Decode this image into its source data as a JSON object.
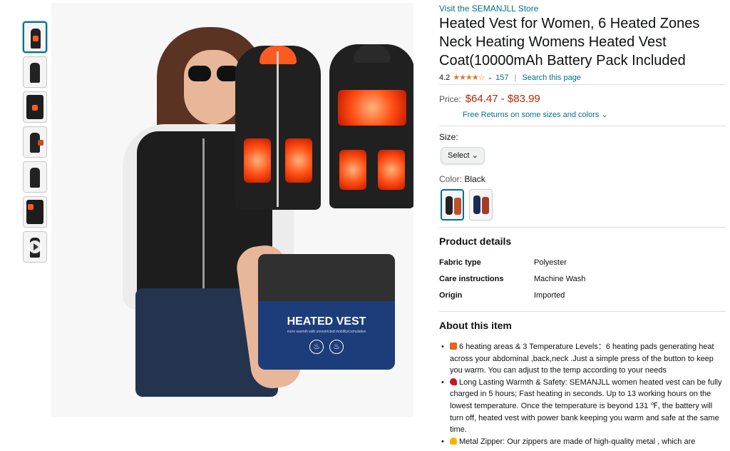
{
  "thumbnails": [
    {
      "kind": "image",
      "active": true
    },
    {
      "kind": "image"
    },
    {
      "kind": "image"
    },
    {
      "kind": "image"
    },
    {
      "kind": "image"
    },
    {
      "kind": "image"
    },
    {
      "kind": "video"
    }
  ],
  "main_image": {
    "bag_label": "HEATED VEST",
    "bag_sub": "more warmth with unrestricted mobility/cumulative"
  },
  "store_link": "Visit the SEMANJLL Store",
  "title": "Heated Vest for Women, 6 Heated Zones Neck Heating Womens Heated Vest Coat(10000mAh Battery Pack Included",
  "rating": {
    "value": "4.2",
    "stars": "★★★★☆",
    "count": "157",
    "search": "Search this page"
  },
  "price": {
    "label": "Price:",
    "range": "$64.47 - $83.99"
  },
  "returns": "Free Returns on some sizes and colors",
  "size": {
    "label": "Size:",
    "select": "Select"
  },
  "color": {
    "label": "Color:",
    "value": "Black",
    "swatches": [
      "Black",
      "Navy"
    ]
  },
  "product_details": {
    "heading": "Product details",
    "rows": [
      {
        "k": "Fabric type",
        "v": "Polyester"
      },
      {
        "k": "Care instructions",
        "v": "Machine Wash"
      },
      {
        "k": "Origin",
        "v": "Imported"
      }
    ]
  },
  "about": {
    "heading": "About this item",
    "items": [
      {
        "icon": "fire",
        "color": "#e8631a",
        "text": "6 heating areas & 3 Temperature Levels：6 heating pads generating heat across your abdominal ,back,neck .Just a simple press of the button to keep you warm. You can adjust to the temp according to your needs"
      },
      {
        "icon": "heart",
        "color": "#c0192b",
        "text": "Long Lasting Warmth & Safety: SEMANJLL women heated vest can be fully charged in 5 hours; Fast heating in seconds. Up to 13 working hours on the lowest temperature. Once the temperature is beyond 131 ℉, the battery will turn off, heated vest with power bank keeping you warm and safe at the same time."
      },
      {
        "icon": "bell",
        "color": "#f4b400",
        "text": "Metal Zipper: Our zippers are made of high-quality metal , which are"
      }
    ]
  }
}
